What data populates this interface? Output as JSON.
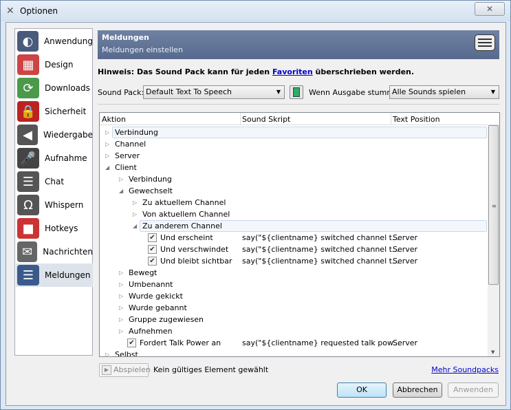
{
  "window": {
    "title": "Optionen",
    "close_icon": "close-icon"
  },
  "sidebar": {
    "items": [
      {
        "label": "Anwendung",
        "icon": "teamspeak-icon",
        "color": "#4a5a7a"
      },
      {
        "label": "Design",
        "icon": "design-icon",
        "color": "#c44"
      },
      {
        "label": "Downloads",
        "icon": "downloads-icon",
        "color": "#4a9a4a"
      },
      {
        "label": "Sicherheit",
        "icon": "lock-icon",
        "color": "#b22"
      },
      {
        "label": "Wiedergabe",
        "icon": "speaker-icon",
        "color": "#555"
      },
      {
        "label": "Aufnahme",
        "icon": "microphone-icon",
        "color": "#444"
      },
      {
        "label": "Chat",
        "icon": "chat-icon",
        "color": "#555"
      },
      {
        "label": "Whispern",
        "icon": "headset-icon",
        "color": "#555"
      },
      {
        "label": "Hotkeys",
        "icon": "hotkeys-icon",
        "color": "#c33"
      },
      {
        "label": "Nachrichten",
        "icon": "messages-icon",
        "color": "#666"
      },
      {
        "label": "Meldungen",
        "icon": "notifications-icon",
        "color": "#3a5a8a",
        "selected": true
      }
    ]
  },
  "header": {
    "title": "Meldungen",
    "subtitle": "Meldungen einstellen"
  },
  "hint": {
    "before": "Hinweis: Das Sound Pack kann für jeden ",
    "link": "Favoriten",
    "after": " überschrieben werden."
  },
  "soundpack": {
    "label": "Sound Pack:",
    "value": "Default Text To Speech",
    "mute_label": "Wenn Ausgabe stumm:",
    "mute_value": "Alle Sounds spielen"
  },
  "tree": {
    "columns": [
      "Aktion",
      "Sound Skript",
      "Text Position"
    ],
    "rows": [
      {
        "level": 0,
        "arrow": "closed",
        "label": "Verbindung",
        "highlight": true
      },
      {
        "level": 0,
        "arrow": "closed",
        "label": "Channel"
      },
      {
        "level": 0,
        "arrow": "closed",
        "label": "Server"
      },
      {
        "level": 0,
        "arrow": "open",
        "label": "Client"
      },
      {
        "level": 1,
        "arrow": "closed",
        "label": "Verbindung"
      },
      {
        "level": 1,
        "arrow": "open",
        "label": "Gewechselt"
      },
      {
        "level": 2,
        "arrow": "closed",
        "label": "Zu aktuellem Channel"
      },
      {
        "level": 2,
        "arrow": "closed",
        "label": "Von aktuellem Channel"
      },
      {
        "level": 2,
        "arrow": "open",
        "label": "Zu anderem Channel",
        "highlight": true
      },
      {
        "level": 3,
        "check": true,
        "label": "Und erscheint",
        "script": "say(\"${clientname} switched channel t...",
        "position": "Server"
      },
      {
        "level": 3,
        "check": true,
        "label": "Und verschwindet",
        "script": "say(\"${clientname} switched channel t...",
        "position": "Server"
      },
      {
        "level": 3,
        "check": true,
        "label": "Und bleibt sichtbar",
        "script": "say(\"${clientname} switched channel t...",
        "position": "Server"
      },
      {
        "level": 1,
        "arrow": "closed",
        "label": "Bewegt"
      },
      {
        "level": 1,
        "arrow": "closed",
        "label": "Umbenannt"
      },
      {
        "level": 1,
        "arrow": "closed",
        "label": "Wurde gekickt"
      },
      {
        "level": 1,
        "arrow": "closed",
        "label": "Wurde gebannt"
      },
      {
        "level": 1,
        "arrow": "closed",
        "label": "Gruppe zugewiesen"
      },
      {
        "level": 1,
        "arrow": "closed",
        "label": "Aufnehmen"
      },
      {
        "level": 1.5,
        "check": true,
        "label": "Fordert Talk Power an",
        "script": "say(\"${clientname} requested talk pow...",
        "position": "Server"
      },
      {
        "level": 0,
        "arrow": "closed",
        "label": "Selbst"
      }
    ]
  },
  "footer": {
    "play_label": "Abspielen",
    "status": "Kein gültiges Element gewählt",
    "more_link": "Mehr Soundpacks",
    "ok": "OK",
    "cancel": "Abbrechen",
    "apply": "Anwenden"
  }
}
